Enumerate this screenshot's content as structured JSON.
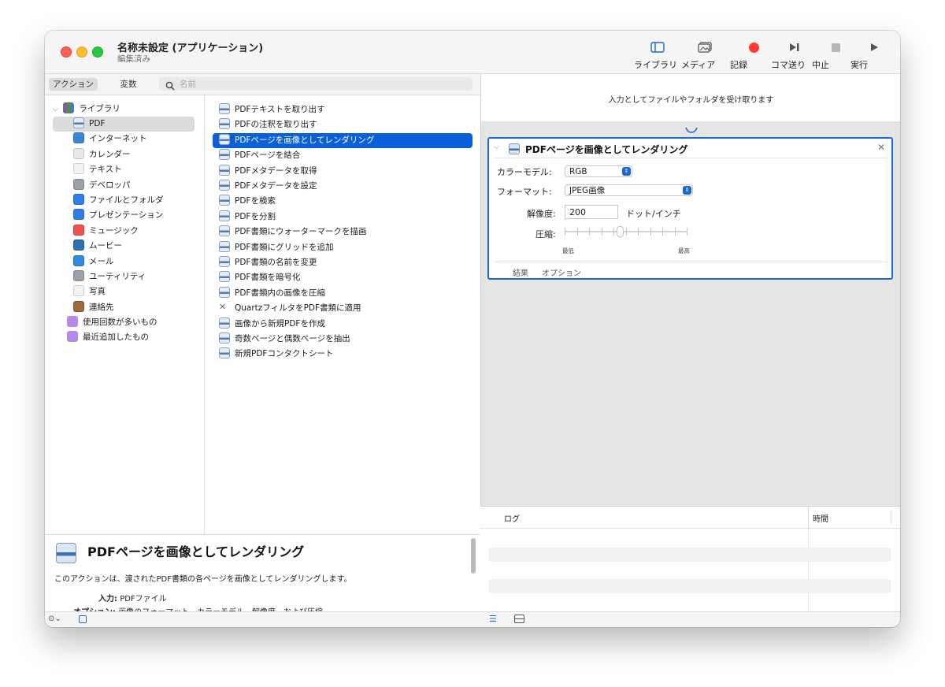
{
  "window": {
    "title": "名称未設定 (アプリケーション)",
    "subtitle": "編集済み"
  },
  "toolbar": {
    "library": "ライブラリ",
    "media": "メディア",
    "record": "記録",
    "step": "コマ送り",
    "stop": "中止",
    "run": "実行"
  },
  "left_header": {
    "tab_actions": "アクション",
    "tab_variables": "変数",
    "search_placeholder": "名前"
  },
  "library": {
    "root": "ライブラリ",
    "items": [
      "PDF",
      "インターネット",
      "カレンダー",
      "テキスト",
      "デベロッパ",
      "ファイルとフォルダ",
      "プレゼンテーション",
      "ミュージック",
      "ムービー",
      "メール",
      "ユーティリティ",
      "写真",
      "連絡先"
    ],
    "smart_groups": [
      "使用回数が多いもの",
      "最近追加したもの"
    ]
  },
  "actions": [
    "PDFテキストを取り出す",
    "PDFの注釈を取り出す",
    "PDFページを画像としてレンダリング",
    "PDFページを結合",
    "PDFメタデータを取得",
    "PDFメタデータを設定",
    "PDFを検索",
    "PDFを分割",
    "PDF書類にウォーターマークを描画",
    "PDF書類にグリッドを追加",
    "PDF書類の名前を変更",
    "PDF書類を暗号化",
    "PDF書類内の画像を圧縮",
    "QuartzフィルタをPDF書類に適用",
    "画像から新規PDFを作成",
    "奇数ページと偶数ページを抽出",
    "新規PDFコンタクトシート"
  ],
  "description": {
    "title": "PDFページを画像としてレンダリング",
    "text": "このアクションは、渡されたPDF書類の各ページを画像としてレンダリングします。",
    "input_label": "入力:",
    "input_value": "PDFファイル",
    "options_label": "オプション:",
    "options_value": "画像のフォーマット、カラーモデル、解像度、および圧縮"
  },
  "workflow": {
    "input_header": "入力としてファイルやフォルダを受け取ります",
    "card": {
      "title": "PDFページを画像としてレンダリング",
      "color_model_label": "カラーモデル:",
      "color_model_value": "RGB",
      "format_label": "フォーマット:",
      "format_value": "JPEG画像",
      "resolution_label": "解像度:",
      "resolution_value": "200",
      "resolution_unit": "ドット/インチ",
      "compression_label": "圧縮:",
      "compression_min": "最低",
      "compression_max": "最高",
      "compression_level": 0.45,
      "tab_results": "結果",
      "tab_options": "オプション"
    }
  },
  "log": {
    "col_log": "ログ",
    "col_time": "時間"
  },
  "colors": {
    "accent": "#1a67d6",
    "selection": "#0a60d9"
  }
}
